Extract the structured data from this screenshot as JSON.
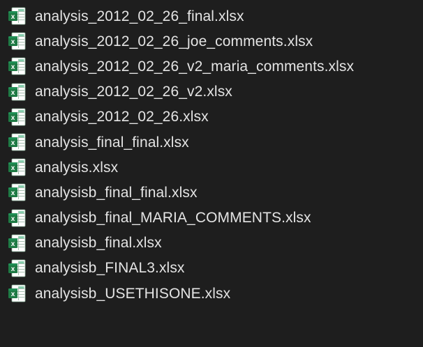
{
  "files": [
    {
      "name": "analysis_2012_02_26_final.xlsx",
      "icon": "excel-file-icon"
    },
    {
      "name": "analysis_2012_02_26_joe_comments.xlsx",
      "icon": "excel-file-icon"
    },
    {
      "name": "analysis_2012_02_26_v2_maria_comments.xlsx",
      "icon": "excel-file-icon"
    },
    {
      "name": "analysis_2012_02_26_v2.xlsx",
      "icon": "excel-file-icon"
    },
    {
      "name": "analysis_2012_02_26.xlsx",
      "icon": "excel-file-icon"
    },
    {
      "name": "analysis_final_final.xlsx",
      "icon": "excel-file-icon"
    },
    {
      "name": "analysis.xlsx",
      "icon": "excel-file-icon"
    },
    {
      "name": "analysisb_final_final.xlsx",
      "icon": "excel-file-icon"
    },
    {
      "name": "analysisb_final_MARIA_COMMENTS.xlsx",
      "icon": "excel-file-icon"
    },
    {
      "name": "analysisb_final.xlsx",
      "icon": "excel-file-icon"
    },
    {
      "name": "analysisb_FINAL3.xlsx",
      "icon": "excel-file-icon"
    },
    {
      "name": "analysisb_USETHISONE.xlsx",
      "icon": "excel-file-icon"
    }
  ],
  "colors": {
    "background": "#1e1e1e",
    "text": "#e4e4e4",
    "excel_green": "#1e7a44",
    "excel_dark_green": "#185c37",
    "sheet_white": "#ffffff",
    "grid_line": "#9bb8a6"
  }
}
